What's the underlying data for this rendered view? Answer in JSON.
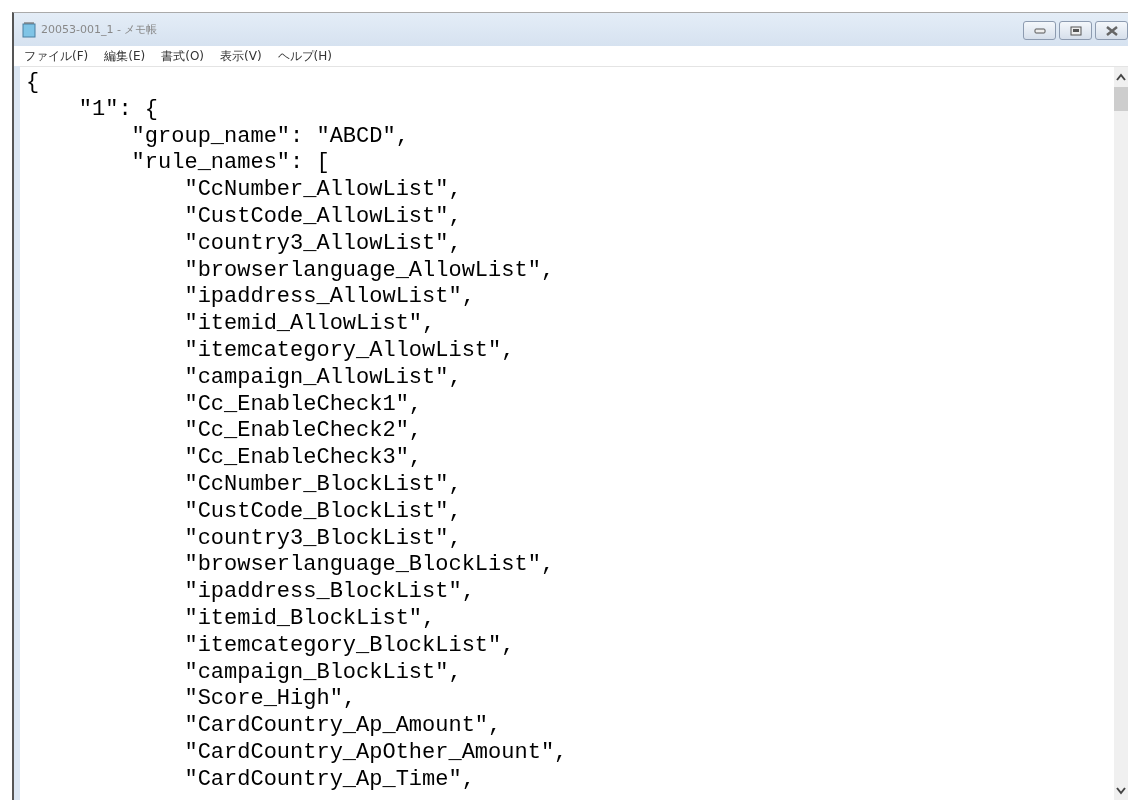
{
  "window": {
    "title": "20053-001_1 - メモ帳"
  },
  "menu": [
    "ファイル(F)",
    "編集(E)",
    "書式(O)",
    "表示(V)",
    "ヘルプ(H)"
  ],
  "editor": {
    "lines": [
      "{",
      "    \"1\": {",
      "        \"group_name\": \"ABCD\",",
      "        \"rule_names\": [",
      "            \"CcNumber_AllowList\",",
      "            \"CustCode_AllowList\",",
      "            \"country3_AllowList\",",
      "            \"browserlanguage_AllowList\",",
      "            \"ipaddress_AllowList\",",
      "            \"itemid_AllowList\",",
      "            \"itemcategory_AllowList\",",
      "            \"campaign_AllowList\",",
      "            \"Cc_EnableCheck1\",",
      "            \"Cc_EnableCheck2\",",
      "            \"Cc_EnableCheck3\",",
      "            \"CcNumber_BlockList\",",
      "            \"CustCode_BlockList\",",
      "            \"country3_BlockList\",",
      "            \"browserlanguage_BlockList\",",
      "            \"ipaddress_BlockList\",",
      "            \"itemid_BlockList\",",
      "            \"itemcategory_BlockList\",",
      "            \"campaign_BlockList\",",
      "            \"Score_High\",",
      "            \"CardCountry_Ap_Amount\",",
      "            \"CardCountry_ApOther_Amount\",",
      "            \"CardCountry_Ap_Time\","
    ]
  }
}
